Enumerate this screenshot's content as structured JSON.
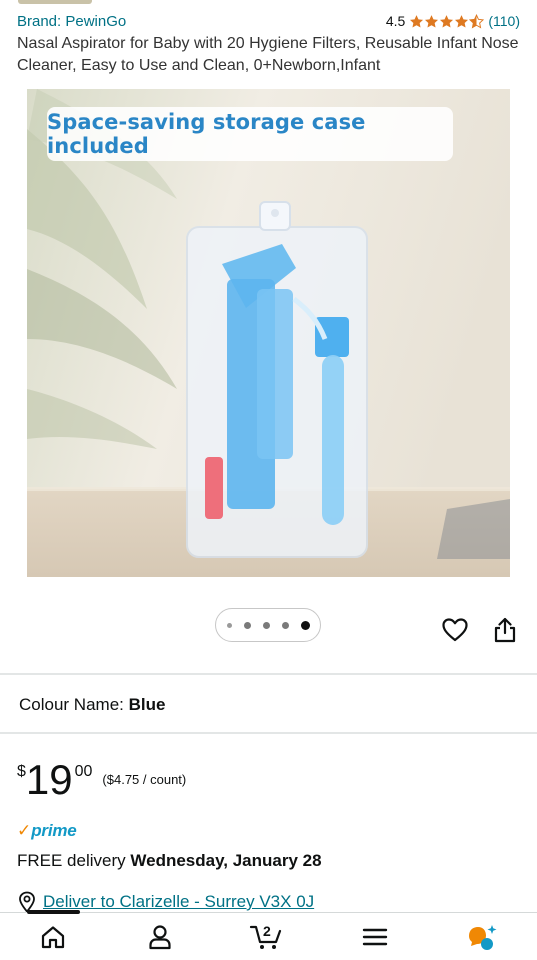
{
  "product": {
    "brand_label": "Brand: PewinGo",
    "rating_value": "4.5",
    "rating_stars": 4.5,
    "review_count": "(110)",
    "title": "Nasal Aspirator for Baby with 20 Hygiene Filters, Reusable Infant Nose Cleaner, Easy to Use and Clean, 0+Newborn,Infant",
    "image_caption": "Space-saving storage case included",
    "image_count": 5,
    "active_image_index": 4
  },
  "colour": {
    "label": "Colour Name:",
    "value": "Blue"
  },
  "price": {
    "currency": "$",
    "whole": "19",
    "fraction": "00",
    "unit_price": "($4.75 / count)"
  },
  "prime": {
    "check": "✓",
    "label": "prime"
  },
  "delivery": {
    "prefix": "FREE delivery",
    "date": "Wednesday, January 28"
  },
  "location": {
    "text": "Deliver to Clarizelle - Surrey V3X 0J"
  },
  "nav": {
    "cart_count": "2",
    "items": [
      "home-icon",
      "account-icon",
      "cart-icon",
      "menu-icon",
      "rufus-icon"
    ]
  },
  "colors": {
    "link": "#007185",
    "prime_blue": "#1399c6",
    "prime_orange": "#f08804",
    "star": "#de7921",
    "caption_text": "#2a86c6"
  }
}
